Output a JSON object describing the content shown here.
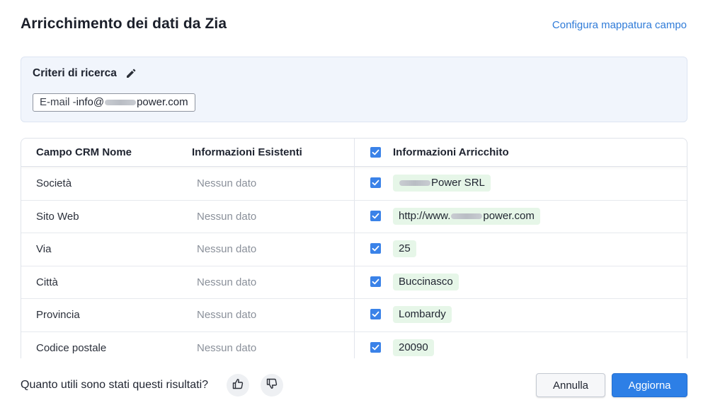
{
  "dialog": {
    "title": "Arricchimento dei dati da Zia",
    "config_link": "Configura mappatura campo"
  },
  "criteria": {
    "title": "Criteri di ricerca",
    "edit_icon": "pencil-icon",
    "email_label": "E-mail - ",
    "email_prefix": "info@",
    "email_suffix": "power.com"
  },
  "table": {
    "headers": {
      "field": "Campo CRM Nome",
      "existing": "Informazioni Esistenti",
      "enriched": "Informazioni Arricchito",
      "enriched_checked": true
    },
    "rows": [
      {
        "field": "Società",
        "existing": "Nessun dato",
        "checked": true,
        "value_prefix": "",
        "value": "Power SRL",
        "redacted": true
      },
      {
        "field": "Sito Web",
        "existing": "Nessun dato",
        "checked": true,
        "value_prefix": "http://www.",
        "value": "power.com",
        "redacted": true
      },
      {
        "field": "Via",
        "existing": "Nessun dato",
        "checked": true,
        "value_prefix": "",
        "value": "25",
        "redacted": false
      },
      {
        "field": "Città",
        "existing": "Nessun dato",
        "checked": true,
        "value_prefix": "",
        "value": "Buccinasco",
        "redacted": false
      },
      {
        "field": "Provincia",
        "existing": "Nessun dato",
        "checked": true,
        "value_prefix": "",
        "value": "Lombardy",
        "redacted": false
      },
      {
        "field": "Codice postale",
        "existing": "Nessun dato",
        "checked": true,
        "value_prefix": "",
        "value": "20090",
        "redacted": false
      }
    ]
  },
  "footer": {
    "question": "Quanto utili sono stati questi risultati?",
    "thumbs_up_icon": "thumbs-up-icon",
    "thumbs_down_icon": "thumbs-down-icon",
    "cancel_label": "Annulla",
    "update_label": "Aggiorna"
  },
  "colors": {
    "accent": "#2d7fe6",
    "link": "#2f7bd8",
    "value_chip_bg": "#e6f6e8",
    "criteria_bg": "#f1f5fc"
  }
}
